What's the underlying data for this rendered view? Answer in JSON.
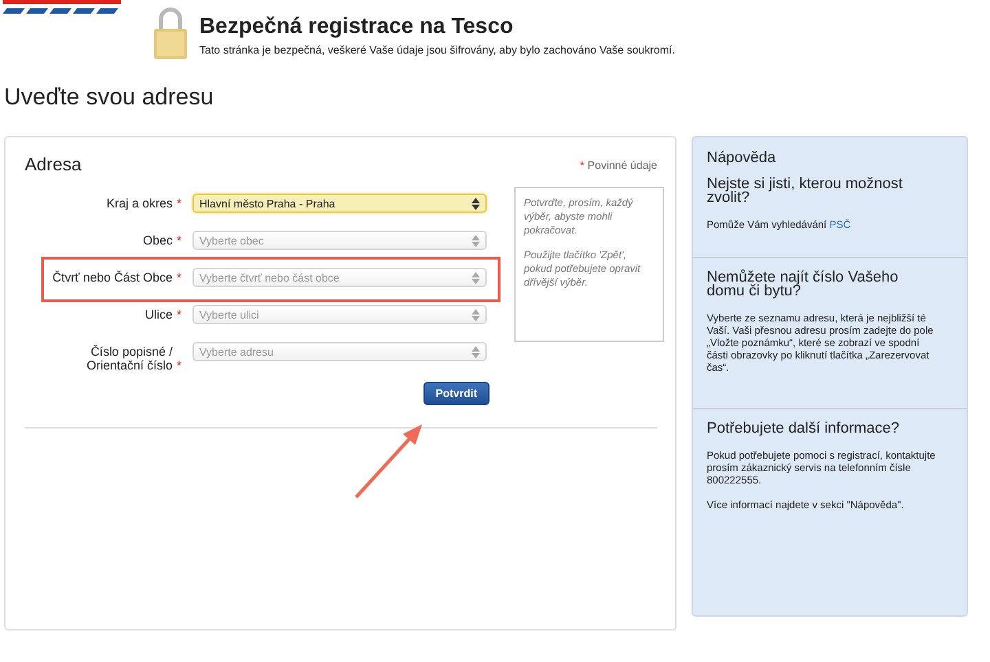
{
  "header": {
    "title": "Bezpečná registrace na Tesco",
    "subtitle": "Tato stránka je bezpečná, veškeré Vaše údaje jsou šifrovány, aby bylo zachováno Vaše soukromí."
  },
  "page_title": "Uveďte svou adresu",
  "form": {
    "title": "Adresa",
    "required_mark": "*",
    "required_note": "Povinné údaje",
    "fields": [
      {
        "label": "Kraj a okres",
        "required": true,
        "value": "Hlavní město Praha - Praha",
        "focused": true,
        "annotated": false
      },
      {
        "label": "Obec",
        "required": true,
        "placeholder": "Vyberte obec",
        "focused": false,
        "annotated": false
      },
      {
        "label": "Čtvrť nebo Část Obce",
        "required": true,
        "placeholder": "Vyberte čtvrť nebo část obce",
        "focused": false,
        "annotated": true
      },
      {
        "label": "Ulice",
        "required": true,
        "placeholder": "Vyberte ulici",
        "focused": false,
        "annotated": false
      },
      {
        "label": "Číslo popisné / Orientační číslo",
        "required": true,
        "placeholder": "Vyberte adresu",
        "focused": false,
        "annotated": false
      }
    ],
    "hint": [
      "Potvrďte, prosím, každý výběr, abyste mohli pokračovat.",
      "Použijte tlačítko 'Zpět', pokud potřebujete opravit dřívější výběr."
    ],
    "submit": "Potvrdit"
  },
  "help": {
    "title": "Nápověda",
    "sections": [
      {
        "heading": "Nejste si jisti, kterou možnost zvolit?",
        "paragraphs": [
          {
            "text": "Pomůže Vám vyhledávání",
            "link": "PSČ"
          }
        ]
      },
      {
        "heading": "Nemůžete najít číslo Vašeho domu či bytu?",
        "paragraphs": [
          {
            "text": "Vyberte ze seznamu adresu, která je nejbližší té Vaší. Vaši přesnou adresu prosím zadejte do pole „Vložte poznámku“, které se zobrazí ve spodní části obrazovky po kliknutí tlačítka „Zarezervovat čas“."
          }
        ]
      },
      {
        "heading": "Potřebujete další informace?",
        "paragraphs": [
          {
            "text": "Pokud potřebujete pomoci s registrací, kontaktujte prosím zákaznický servis na telefonním čísle 800222555."
          },
          {
            "text": "Více informací najdete v sekci \"Nápověda\"."
          }
        ]
      }
    ]
  }
}
